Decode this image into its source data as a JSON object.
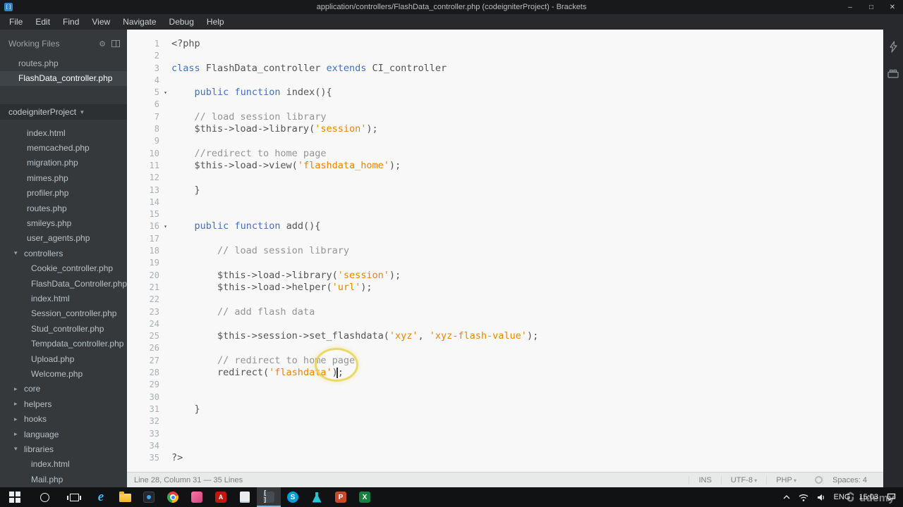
{
  "window": {
    "title": "application/controllers/FlashData_controller.php (codeigniterProject) - Brackets",
    "controls": {
      "minimize": "–",
      "maximize": "□",
      "close": "✕"
    },
    "menus": [
      "File",
      "Edit",
      "Find",
      "View",
      "Navigate",
      "Debug",
      "Help"
    ]
  },
  "sidebar": {
    "working_files_title": "Working Files",
    "working_files": [
      {
        "label": "routes.php",
        "active": false
      },
      {
        "label": "FlashData_controller.php",
        "active": true
      }
    ],
    "project_name": "codeigniterProject",
    "tree": [
      {
        "label": "index.html",
        "type": "file",
        "level": 1
      },
      {
        "label": "memcached.php",
        "type": "file",
        "level": 1
      },
      {
        "label": "migration.php",
        "type": "file",
        "level": 1
      },
      {
        "label": "mimes.php",
        "type": "file",
        "level": 1
      },
      {
        "label": "profiler.php",
        "type": "file",
        "level": 1
      },
      {
        "label": "routes.php",
        "type": "file",
        "level": 1
      },
      {
        "label": "smileys.php",
        "type": "file",
        "level": 1
      },
      {
        "label": "user_agents.php",
        "type": "file",
        "level": 1
      },
      {
        "label": "controllers",
        "type": "folder",
        "state": "expanded"
      },
      {
        "label": "Cookie_controller.php",
        "type": "file",
        "level": 2
      },
      {
        "label": "FlashData_Controller.php",
        "type": "file",
        "level": 2
      },
      {
        "label": "index.html",
        "type": "file",
        "level": 2
      },
      {
        "label": "Session_controller.php",
        "type": "file",
        "level": 2
      },
      {
        "label": "Stud_controller.php",
        "type": "file",
        "level": 2
      },
      {
        "label": "Tempdata_controller.php",
        "type": "file",
        "level": 2
      },
      {
        "label": "Upload.php",
        "type": "file",
        "level": 2
      },
      {
        "label": "Welcome.php",
        "type": "file",
        "level": 2
      },
      {
        "label": "core",
        "type": "folder",
        "state": "collapsed"
      },
      {
        "label": "helpers",
        "type": "folder",
        "state": "collapsed"
      },
      {
        "label": "hooks",
        "type": "folder",
        "state": "collapsed"
      },
      {
        "label": "language",
        "type": "folder",
        "state": "collapsed"
      },
      {
        "label": "libraries",
        "type": "folder",
        "state": "expanded"
      },
      {
        "label": "index.html",
        "type": "file",
        "level": 2
      },
      {
        "label": "Mail.php",
        "type": "file",
        "level": 2
      }
    ]
  },
  "editor": {
    "cursor": {
      "line": 28,
      "column": 31
    },
    "colors": {
      "keyword": "#446fbd",
      "string": "#e88501",
      "comment": "#949494",
      "text": "#535353",
      "background": "#f8f8f8",
      "click_highlight": "#e9d44e"
    },
    "lines": [
      {
        "n": 1,
        "segs": [
          [
            "meta",
            "<?php"
          ]
        ]
      },
      {
        "n": 2,
        "segs": []
      },
      {
        "n": 3,
        "segs": [
          [
            "kw",
            "class"
          ],
          [
            "id",
            " FlashData_controller "
          ],
          [
            "kw",
            "extends"
          ],
          [
            "id",
            " CI_controller"
          ]
        ]
      },
      {
        "n": 4,
        "segs": []
      },
      {
        "n": 5,
        "fold": true,
        "segs": [
          [
            "id",
            "    "
          ],
          [
            "kw",
            "public"
          ],
          [
            "id",
            " "
          ],
          [
            "kw",
            "function"
          ],
          [
            "id",
            " index(){"
          ]
        ]
      },
      {
        "n": 6,
        "segs": []
      },
      {
        "n": 7,
        "segs": [
          [
            "cmt",
            "    // load session library"
          ]
        ]
      },
      {
        "n": 8,
        "segs": [
          [
            "id",
            "    $this->load->library("
          ],
          [
            "str",
            "'session'"
          ],
          [
            "id",
            ");"
          ]
        ]
      },
      {
        "n": 9,
        "segs": []
      },
      {
        "n": 10,
        "segs": [
          [
            "cmt",
            "    //redirect to home page"
          ]
        ]
      },
      {
        "n": 11,
        "segs": [
          [
            "id",
            "    $this->load->view("
          ],
          [
            "str",
            "'flashdata_home'"
          ],
          [
            "id",
            ");"
          ]
        ]
      },
      {
        "n": 12,
        "segs": []
      },
      {
        "n": 13,
        "segs": [
          [
            "id",
            "    }"
          ]
        ]
      },
      {
        "n": 14,
        "segs": []
      },
      {
        "n": 15,
        "segs": []
      },
      {
        "n": 16,
        "fold": true,
        "segs": [
          [
            "id",
            "    "
          ],
          [
            "kw",
            "public"
          ],
          [
            "id",
            " "
          ],
          [
            "kw",
            "function"
          ],
          [
            "id",
            " add(){"
          ]
        ]
      },
      {
        "n": 17,
        "segs": []
      },
      {
        "n": 18,
        "segs": [
          [
            "cmt",
            "        // load session library"
          ]
        ]
      },
      {
        "n": 19,
        "segs": []
      },
      {
        "n": 20,
        "segs": [
          [
            "id",
            "        $this->load->library("
          ],
          [
            "str",
            "'session'"
          ],
          [
            "id",
            ");"
          ]
        ]
      },
      {
        "n": 21,
        "segs": [
          [
            "id",
            "        $this->load->helper("
          ],
          [
            "str",
            "'url'"
          ],
          [
            "id",
            ");"
          ]
        ]
      },
      {
        "n": 22,
        "segs": []
      },
      {
        "n": 23,
        "segs": [
          [
            "cmt",
            "        // add flash data"
          ]
        ]
      },
      {
        "n": 24,
        "segs": []
      },
      {
        "n": 25,
        "segs": [
          [
            "id",
            "        $this->session->set_flashdata("
          ],
          [
            "str",
            "'xyz'"
          ],
          [
            "id",
            ", "
          ],
          [
            "str",
            "'xyz-flash-value'"
          ],
          [
            "id",
            ");"
          ]
        ]
      },
      {
        "n": 26,
        "segs": []
      },
      {
        "n": 27,
        "segs": [
          [
            "cmt",
            "        // redirect to home page"
          ]
        ]
      },
      {
        "n": 28,
        "segs": [
          [
            "id",
            "        redirect("
          ],
          [
            "str",
            "'flashdata'"
          ],
          [
            "id",
            ");"
          ]
        ]
      },
      {
        "n": 29,
        "segs": []
      },
      {
        "n": 30,
        "segs": []
      },
      {
        "n": 31,
        "segs": [
          [
            "id",
            "    }"
          ]
        ]
      },
      {
        "n": 32,
        "segs": []
      },
      {
        "n": 33,
        "segs": []
      },
      {
        "n": 34,
        "segs": []
      },
      {
        "n": 35,
        "segs": [
          [
            "meta",
            "?>"
          ]
        ]
      }
    ]
  },
  "statusbar": {
    "position": "Line 28, Column 31 — 35 Lines",
    "insert_mode": "INS",
    "encoding": "UTF-8",
    "language": "PHP",
    "spaces": "Spaces: 4"
  },
  "rail": {
    "icons": [
      "live-preview",
      "extension-manager"
    ]
  },
  "taskbar": {
    "apps": [
      {
        "name": "internet-explorer",
        "glyph": "e"
      },
      {
        "name": "file-explorer"
      },
      {
        "name": "screen-recorder"
      },
      {
        "name": "chrome"
      },
      {
        "name": "photos"
      },
      {
        "name": "acrobat",
        "glyph": "A"
      },
      {
        "name": "notepad"
      },
      {
        "name": "brackets",
        "glyph": "[ ]",
        "active": true
      },
      {
        "name": "skype",
        "glyph": "S"
      },
      {
        "name": "flask-tool"
      },
      {
        "name": "powerpoint",
        "glyph": "P"
      },
      {
        "name": "excel",
        "glyph": "X"
      }
    ],
    "tray": {
      "language_label": "ENG",
      "time": "15:03"
    }
  },
  "watermark": {
    "text": "udemy"
  }
}
